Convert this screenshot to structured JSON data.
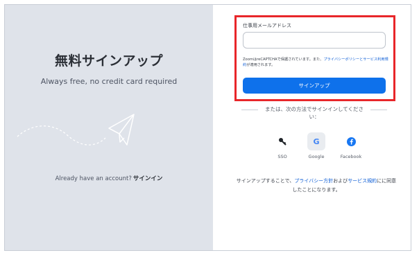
{
  "left": {
    "title": "無料サインアップ",
    "subtitle": "Always free, no credit card required",
    "account_text": "Already have an account?",
    "account_link": "サインイン"
  },
  "form": {
    "email_label": "仕事用メールアドレス",
    "email_value": "",
    "recaptcha_text": "ZoomはreCAPTCHAで保護されています。また、",
    "recaptcha_link": "プライバシーポリシーとサービス利用規約",
    "recaptcha_suffix": "が適用されます。",
    "signup_button": "サインアップ"
  },
  "divider_text": "または、次の方法でサインインしてください：",
  "sso_options": [
    {
      "label": "SSO",
      "icon": "key-icon"
    },
    {
      "label": "Google",
      "icon": "google-icon"
    },
    {
      "label": "Facebook",
      "icon": "facebook-icon"
    }
  ],
  "terms": {
    "prefix": "サインアップすることで、",
    "privacy_link": "プライバシー方針",
    "and": "および",
    "terms_link": "サービス規約",
    "suffix": "にに同意したことになります。"
  },
  "colors": {
    "accent": "#0e71eb",
    "highlight_box": "#e8262a",
    "left_panel": "#dfe3ea",
    "facebook": "#1877f2"
  }
}
